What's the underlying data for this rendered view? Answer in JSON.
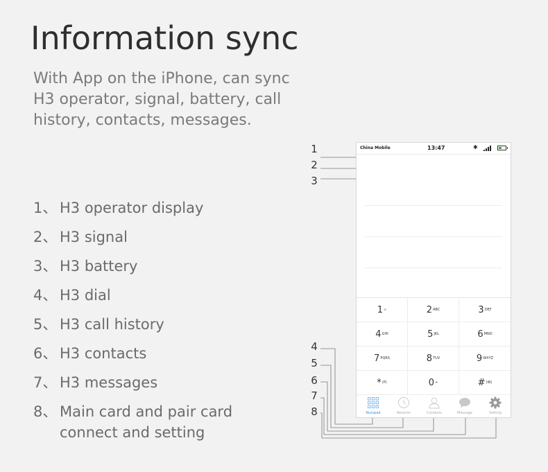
{
  "header": {
    "title": "Information sync",
    "subtitle": "With App on the iPhone, can sync H3 operator, signal, battery, call history, contacts, messages."
  },
  "features": [
    {
      "num": "1、",
      "text": "H3 operator display"
    },
    {
      "num": "2、",
      "text": "H3 signal"
    },
    {
      "num": "3、",
      "text": "H3 battery"
    },
    {
      "num": "4、",
      "text": "H3 dial"
    },
    {
      "num": "5、",
      "text": "H3 call history"
    },
    {
      "num": "6、",
      "text": "H3 contacts"
    },
    {
      "num": "7、",
      "text": "H3 messages"
    },
    {
      "num": "8、",
      "text": "Main card and pair card connect and setting"
    }
  ],
  "phone": {
    "carrier": "China Mobile",
    "time": "13:47",
    "bluetooth_icon": "bluetooth-icon",
    "signal_icon": "signal-bars-icon",
    "battery_icon": "battery-icon",
    "battery_color": "#3aaa3a",
    "keys": [
      {
        "digit": "1",
        "letters": "∞"
      },
      {
        "digit": "2",
        "letters": "ABC"
      },
      {
        "digit": "3",
        "letters": "DEF"
      },
      {
        "digit": "4",
        "letters": "GHI"
      },
      {
        "digit": "5",
        "letters": "JKL"
      },
      {
        "digit": "6",
        "letters": "MNO"
      },
      {
        "digit": "7",
        "letters": "PQRS"
      },
      {
        "digit": "8",
        "letters": "TUV"
      },
      {
        "digit": "9",
        "letters": "WXYZ"
      },
      {
        "digit": "*",
        "letters": "(P)"
      },
      {
        "digit": "0",
        "letters": "+"
      },
      {
        "digit": "#",
        "letters": "(W)"
      }
    ],
    "tabs": [
      {
        "label": "Numpad",
        "icon": "numpad-grid-icon",
        "active": true
      },
      {
        "label": "Recents",
        "icon": "clock-icon",
        "active": false
      },
      {
        "label": "Contacts",
        "icon": "person-icon",
        "active": false
      },
      {
        "label": "Message",
        "icon": "chat-bubble-icon",
        "active": false
      },
      {
        "label": "Setting",
        "icon": "gear-icon",
        "active": false
      }
    ],
    "accent_color": "#2f93e0"
  },
  "callouts": [
    "1",
    "2",
    "3",
    "4",
    "5",
    "6",
    "7",
    "8"
  ]
}
